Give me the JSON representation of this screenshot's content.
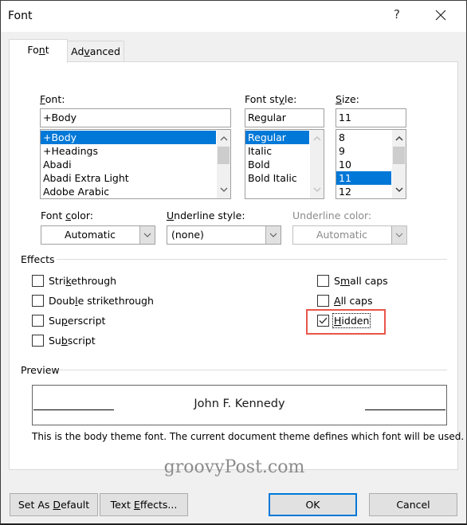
{
  "window": {
    "title": "Font",
    "help_label": "?",
    "close_icon": "close-icon"
  },
  "tabs": [
    {
      "label_pre": "Fo",
      "label_u": "n",
      "label_post": "t",
      "active": true
    },
    {
      "label_pre": "Ad",
      "label_u": "v",
      "label_post": "anced",
      "active": false
    }
  ],
  "font": {
    "label_u": "F",
    "label_post": "ont:",
    "value": "+Body",
    "items": [
      "+Body",
      "+Headings",
      "Abadi",
      "Abadi Extra Light",
      "Adobe Arabic"
    ],
    "selected_index": 0
  },
  "font_style": {
    "label_pre": "Font st",
    "label_u": "y",
    "label_post": "le:",
    "value": "Regular",
    "items": [
      "Regular",
      "Italic",
      "Bold",
      "Bold Italic"
    ],
    "selected_index": 0
  },
  "size": {
    "label_u": "S",
    "label_post": "ize:",
    "value": "11",
    "items": [
      "8",
      "9",
      "10",
      "11",
      "12"
    ],
    "selected_index": 3
  },
  "font_color": {
    "label_pre": "Font ",
    "label_u": "c",
    "label_post": "olor:",
    "value": "Automatic"
  },
  "underline_style": {
    "label_u": "U",
    "label_post": "nderline style:",
    "value": "(none)"
  },
  "underline_color": {
    "label": "Underline color:",
    "value": "Automatic",
    "disabled": true
  },
  "effects": {
    "heading": "Effects",
    "left": [
      {
        "pre": "Stri",
        "u": "k",
        "post": "ethrough",
        "checked": false
      },
      {
        "pre": "Doub",
        "u": "l",
        "post": "e strikethrough",
        "checked": false
      },
      {
        "pre": "Su",
        "u": "p",
        "post": "erscript",
        "checked": false
      },
      {
        "pre": "Su",
        "u": "b",
        "post": "script",
        "checked": false
      }
    ],
    "right": [
      {
        "pre": "S",
        "u": "m",
        "post": "all caps",
        "checked": false
      },
      {
        "pre": "",
        "u": "A",
        "post": "ll caps",
        "checked": false
      },
      {
        "pre": "",
        "u": "H",
        "post": "idden",
        "checked": true
      }
    ]
  },
  "preview": {
    "heading": "Preview",
    "sample_text": "John F. Kennedy",
    "description": "This is the body theme font. The current document theme defines which font will be used."
  },
  "watermark": "groovyPost.com",
  "buttons": {
    "set_default": {
      "pre": "Set As ",
      "u": "D",
      "post": "efault"
    },
    "text_effects": {
      "pre": "Text ",
      "u": "E",
      "post": "ffects..."
    },
    "ok": "OK",
    "cancel": "Cancel"
  },
  "colors": {
    "selection": "#0078d7",
    "highlight_annotation": "#e8564a",
    "default_button_border": "#0078d7"
  }
}
